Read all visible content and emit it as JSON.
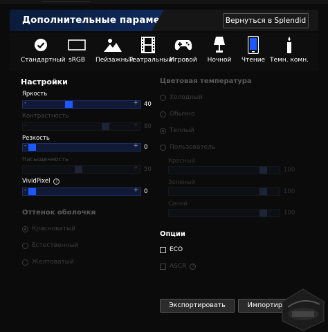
{
  "header": {
    "title": "Дополнительные параметры",
    "back_button": "Вернуться в Splendid"
  },
  "modes": [
    {
      "label": "Стандартный",
      "icon": "check-circle-icon"
    },
    {
      "label": "sRGB",
      "icon": "monitor-outline-icon"
    },
    {
      "label": "Пейзажный",
      "icon": "landscape-icon"
    },
    {
      "label": "Театральный",
      "icon": "film-icon"
    },
    {
      "label": "Игровой",
      "icon": "gamepad-icon"
    },
    {
      "label": "Ночной",
      "icon": "lamp-icon"
    },
    {
      "label": "Чтение",
      "icon": "tablet-icon"
    },
    {
      "label": "Темн. комн.",
      "icon": "candle-icon"
    }
  ],
  "settings": {
    "title": "Настройки",
    "brightness": {
      "label": "Яркость",
      "value": "40",
      "level": 0.4
    },
    "contrast": {
      "label": "Контрастность",
      "value": "80",
      "level": 0.8
    },
    "sharpness": {
      "label": "Резкость",
      "value": "0",
      "level": 0.0
    },
    "saturation": {
      "label": "Насыщенность",
      "value": "50",
      "level": 0.5
    },
    "vividpixel": {
      "label": "VividPixel",
      "help": "?",
      "value": "0",
      "level": 0.0
    },
    "minus": "-",
    "plus": "+"
  },
  "skin_tone": {
    "title": "Оттенок оболочки",
    "options": [
      "Красноватый",
      "Естественный",
      "Желтоватый"
    ],
    "selected": 0
  },
  "color_temp": {
    "title": "Цветовая температура",
    "options": [
      "Холодный",
      "Обычно",
      "Теплый",
      "Пользователь"
    ],
    "selected": 2,
    "red": {
      "label": "Красный",
      "value": "100",
      "level": 1.0
    },
    "green": {
      "label": "Зеленый",
      "value": "100",
      "level": 1.0
    },
    "blue": {
      "label": "Синий",
      "value": "100",
      "level": 1.0
    }
  },
  "options": {
    "title": "Опции",
    "eco": "ECO",
    "ascr": "ASCR",
    "help": "?"
  },
  "footer": {
    "export": "Экспортировать",
    "import": "Импортировать"
  },
  "colors": {
    "accent": "#1c58ff",
    "header": "#0f2f6b"
  }
}
